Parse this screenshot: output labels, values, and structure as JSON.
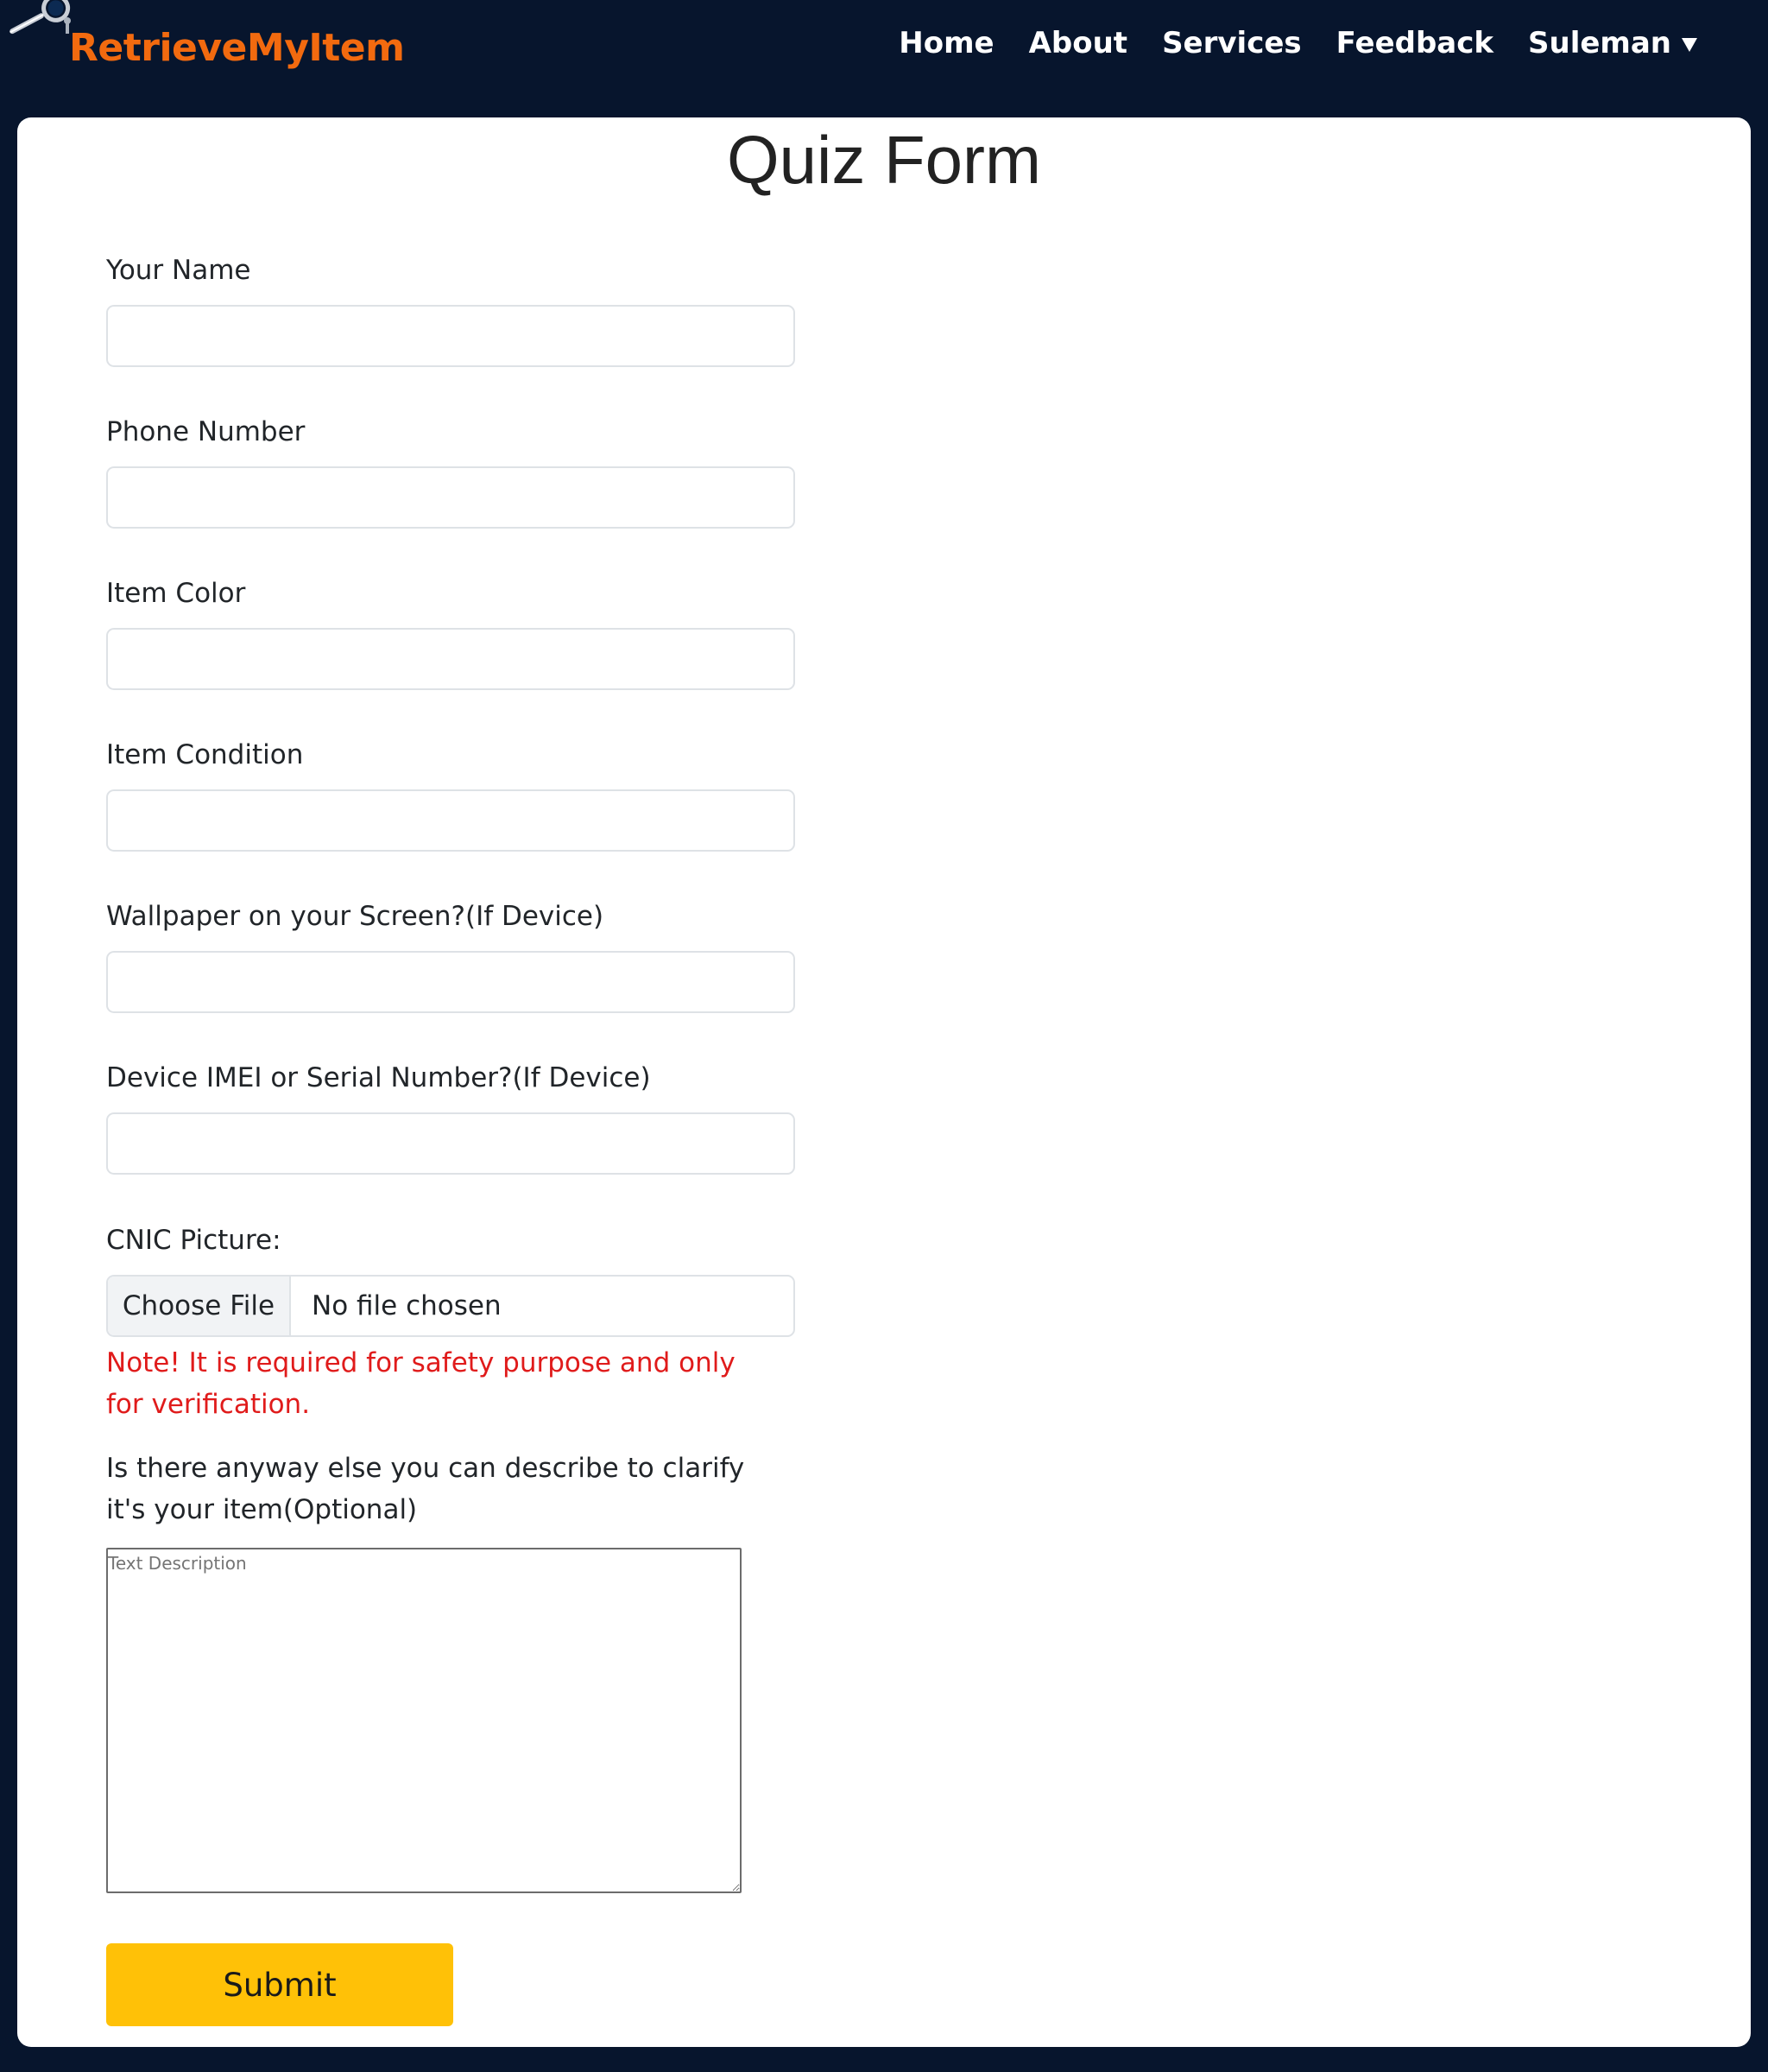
{
  "navbar": {
    "brand": "RetrieveMyItem",
    "links": [
      "Home",
      "About",
      "Services",
      "Feedback"
    ],
    "user": "Suleman"
  },
  "form": {
    "title": "Quiz Form",
    "fields": [
      {
        "label": "Your Name",
        "value": ""
      },
      {
        "label": "Phone Number",
        "value": ""
      },
      {
        "label": "Item Color",
        "value": ""
      },
      {
        "label": "Item Condition",
        "value": ""
      },
      {
        "label": "Wallpaper on your Screen?(If Device)",
        "value": ""
      },
      {
        "label": "Device IMEI or Serial Number?(If Device)",
        "value": ""
      }
    ],
    "file": {
      "label": "CNIC Picture:",
      "button": "Choose File",
      "status": "No file chosen"
    },
    "note": "Note! It is required for safety purpose and only for verification.",
    "description": {
      "label": "Is there anyway else you can describe to clarify it's your item(Optional)",
      "placeholder": "Text Description"
    },
    "submit": "Submit"
  },
  "colors": {
    "background": "#07152d",
    "brand": "#f26a0f",
    "note": "#e01b1b",
    "submit": "#ffc107"
  }
}
